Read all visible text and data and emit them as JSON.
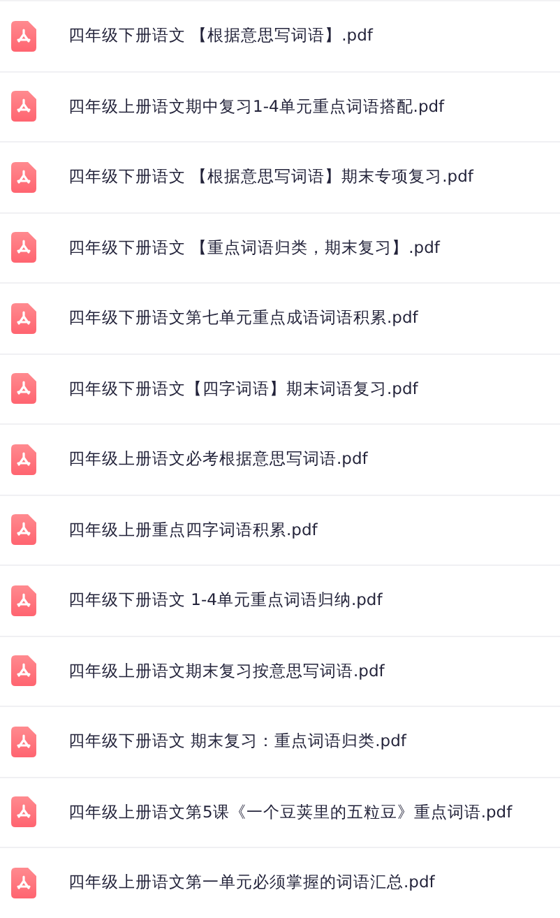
{
  "files": [
    {
      "name": "四年级下册语文 【根据意思写词语】.pdf"
    },
    {
      "name": "四年级上册语文期中复习1-4单元重点词语搭配.pdf"
    },
    {
      "name": "四年级下册语文 【根据意思写词语】期末专项复习.pdf"
    },
    {
      "name": "四年级下册语文 【重点词语归类，期末复习】.pdf"
    },
    {
      "name": "四年级下册语文第七单元重点成语词语积累.pdf"
    },
    {
      "name": "四年级下册语文【四字词语】期末词语复习.pdf"
    },
    {
      "name": "四年级上册语文必考根据意思写词语.pdf"
    },
    {
      "name": "四年级上册重点四字词语积累.pdf"
    },
    {
      "name": "四年级下册语文 1-4单元重点词语归纳.pdf"
    },
    {
      "name": "四年级上册语文期末复习按意思写词语.pdf"
    },
    {
      "name": "四年级下册语文 期末复习：重点词语归类.pdf"
    },
    {
      "name": "四年级上册语文第5课《一个豆荚里的五粒豆》重点词语.pdf"
    },
    {
      "name": "四年级上册语文第一单元必须掌握的词语汇总.pdf"
    }
  ]
}
